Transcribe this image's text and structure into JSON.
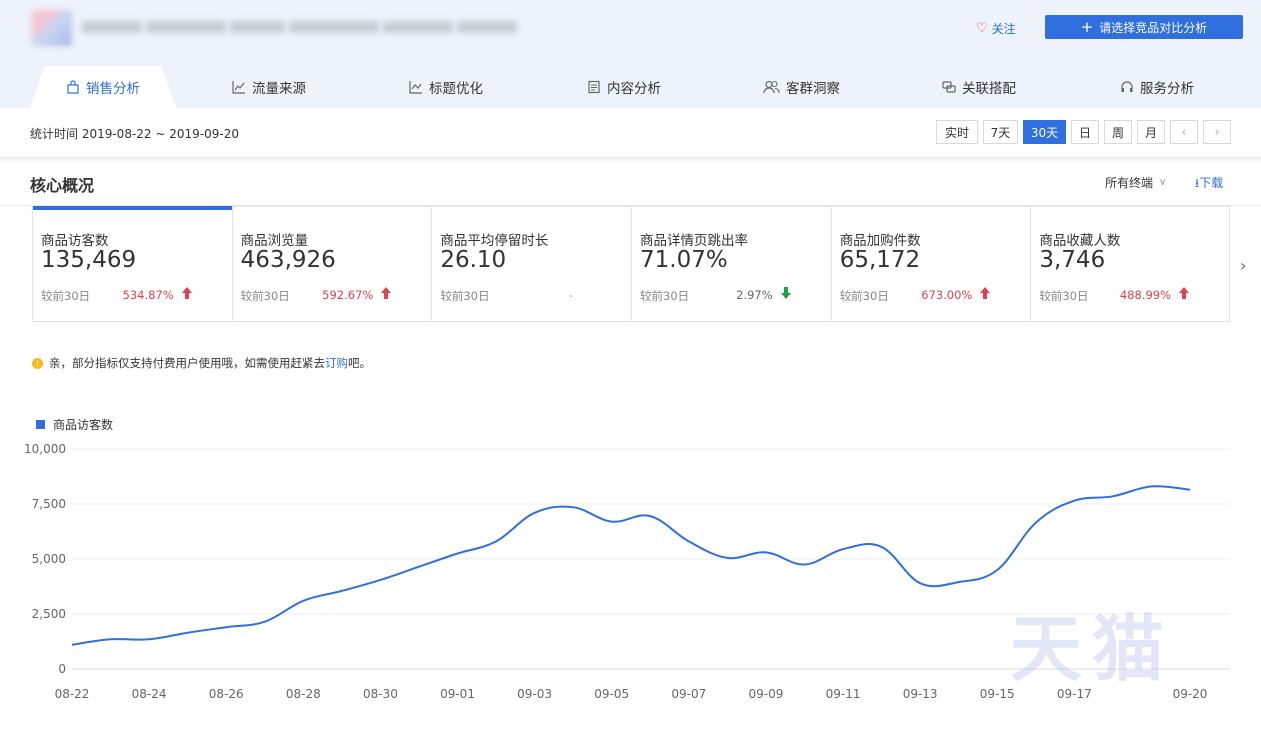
{
  "header": {
    "follow_label": "关注",
    "compare_button": "请选择竞品对比分析"
  },
  "tabs": [
    {
      "label": "销售分析",
      "icon": "bag-icon"
    },
    {
      "label": "流量来源",
      "icon": "line-chart-icon"
    },
    {
      "label": "标题优化",
      "icon": "trend-icon"
    },
    {
      "label": "内容分析",
      "icon": "document-icon"
    },
    {
      "label": "客群洞察",
      "icon": "users-icon"
    },
    {
      "label": "关联搭配",
      "icon": "link-icon"
    },
    {
      "label": "服务分析",
      "icon": "headset-icon"
    }
  ],
  "datebar": {
    "text": "统计时间 2019-08-22 ~ 2019-09-20",
    "ranges": [
      "实时",
      "7天",
      "30天",
      "日",
      "周",
      "月"
    ],
    "selected": "30天"
  },
  "overview": {
    "title": "核心概况",
    "terminal_select": "所有终端",
    "download_label": "下载"
  },
  "cards": [
    {
      "label": "商品访客数",
      "value": "135,469",
      "compare": "较前30日",
      "change": "534.87%",
      "dir": "up"
    },
    {
      "label": "商品浏览量",
      "value": "463,926",
      "compare": "较前30日",
      "change": "592.67%",
      "dir": "up"
    },
    {
      "label": "商品平均停留时长",
      "value": "26.10",
      "compare": "较前30日",
      "change": "-",
      "dir": "flat"
    },
    {
      "label": "商品详情页跳出率",
      "value": "71.07%",
      "compare": "较前30日",
      "change": "2.97%",
      "dir": "down"
    },
    {
      "label": "商品加购件数",
      "value": "65,172",
      "compare": "较前30日",
      "change": "673.00%",
      "dir": "up"
    },
    {
      "label": "商品收藏人数",
      "value": "3,746",
      "compare": "较前30日",
      "change": "488.99%",
      "dir": "up"
    }
  ],
  "notice": {
    "text": "亲，部分指标仅支持付费用户使用哦，如需使用赶紧去",
    "link": "订购",
    "suffix": "吧。"
  },
  "watermark": "天猫",
  "colors": {
    "accent": "#2f6fde",
    "up": "#e0434d",
    "down": "#1aa34a"
  },
  "chart_data": {
    "type": "line",
    "series": [
      {
        "name": "商品访客数",
        "x": [
          "08-22",
          "08-23",
          "08-24",
          "08-25",
          "08-26",
          "08-27",
          "08-28",
          "08-29",
          "08-30",
          "08-31",
          "09-01",
          "09-02",
          "09-03",
          "09-04",
          "09-05",
          "09-06",
          "09-07",
          "09-08",
          "09-09",
          "09-10",
          "09-11",
          "09-12",
          "09-13",
          "09-14",
          "09-15",
          "09-16",
          "09-17",
          "09-18",
          "09-19",
          "09-20"
        ],
        "values": [
          1100,
          1350,
          1350,
          1650,
          1900,
          2150,
          3100,
          3550,
          4050,
          4650,
          5250,
          5800,
          7100,
          7350,
          6700,
          6950,
          5800,
          5050,
          5300,
          4750,
          5450,
          5550,
          3900,
          3950,
          4500,
          6650,
          7650,
          7850,
          8300,
          8150
        ]
      }
    ],
    "x_ticks": [
      "08-22",
      "08-24",
      "08-26",
      "08-28",
      "08-30",
      "09-01",
      "09-03",
      "09-05",
      "09-07",
      "09-09",
      "09-11",
      "09-13",
      "09-15",
      "09-17",
      "09-20"
    ],
    "y_ticks": [
      "0",
      "2,500",
      "5,000",
      "7,500",
      "10,000"
    ],
    "ylim": [
      0,
      10000
    ],
    "grid": true,
    "legend_position": "top-left"
  }
}
